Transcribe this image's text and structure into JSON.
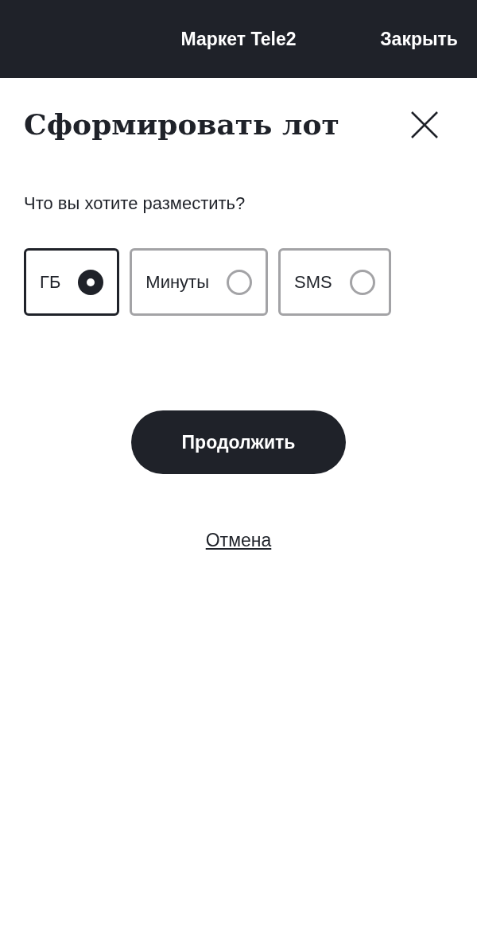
{
  "header": {
    "title": "Маркет Tele2",
    "close_label": "Закрыть"
  },
  "dialog": {
    "title": "Сформировать лот",
    "question": "Что вы хотите разместить?",
    "options": [
      {
        "label": "ГБ",
        "selected": true
      },
      {
        "label": "Минуты",
        "selected": false
      },
      {
        "label": "SMS",
        "selected": false
      }
    ],
    "primary_button": "Продолжить",
    "cancel_link": "Отмена"
  }
}
